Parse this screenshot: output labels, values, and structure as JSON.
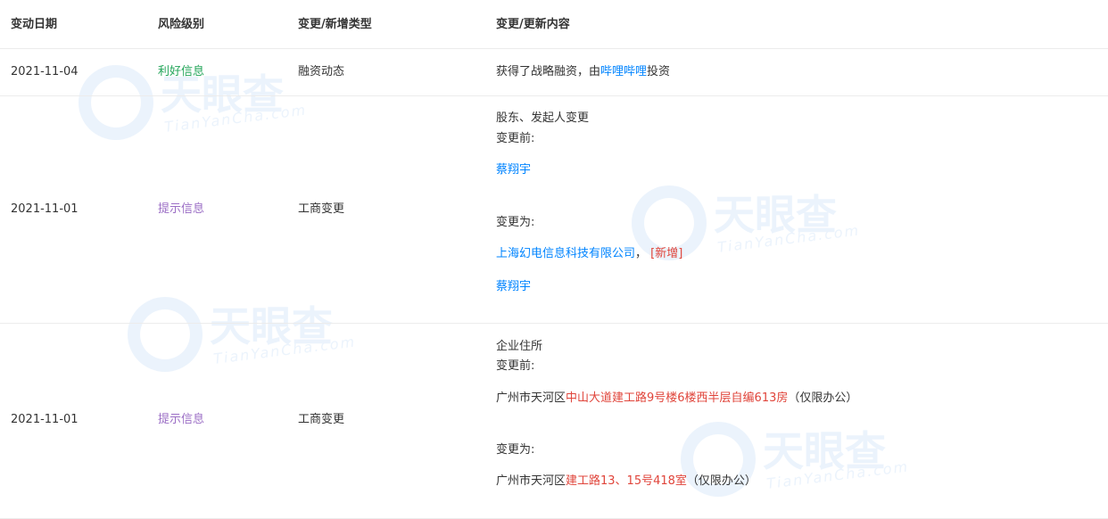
{
  "columns": {
    "date": "变动日期",
    "risk": "风险级别",
    "type": "变更/新增类型",
    "content": "变更/更新内容"
  },
  "watermark": {
    "brand": "天眼查",
    "latin": "TianYanCha.com"
  },
  "colors": {
    "favorable": "#23a559",
    "notice": "#9b6ec5",
    "link": "#0084ff",
    "changed": "#e0453b"
  },
  "rows": [
    {
      "date": "2021-11-04",
      "risk": "利好信息",
      "type": "融资动态",
      "content": {
        "prefix": "获得了战略融资，由",
        "investor": "哔哩哔哩",
        "suffix": "投资"
      }
    },
    {
      "date": "2021-11-01",
      "risk": "提示信息",
      "type": "工商变更",
      "content": {
        "title": "股东、发起人变更",
        "before_label": "变更前:",
        "before_value": "蔡翔宇",
        "after_label": "变更为:",
        "after_value_1": "上海幻电信息科技有限公司",
        "after_value_1_sep": "，",
        "after_value_1_tag": "[新增]",
        "after_value_2": "蔡翔宇"
      }
    },
    {
      "date": "2021-11-01",
      "risk": "提示信息",
      "type": "工商变更",
      "content": {
        "title": "企业住所",
        "before_label": "变更前:",
        "before_prefix": "广州市天河区",
        "before_changed": "中山大道建工路9号楼6楼西半层自编613房",
        "before_suffix": "（仅限办公）",
        "after_label": "变更为:",
        "after_prefix": "广州市天河区",
        "after_changed": "建工路13、15号418室",
        "after_suffix": "（仅限办公）"
      }
    }
  ]
}
